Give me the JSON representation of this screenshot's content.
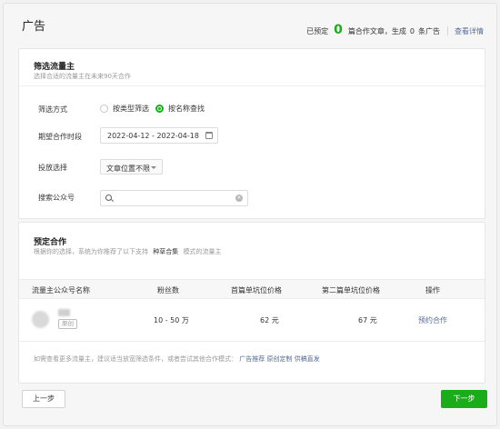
{
  "header": {
    "title": "广告",
    "summary_prefix": "已预定",
    "reserved_count": "0",
    "summary_middle": "篇合作文章，生成",
    "ad_count": "0",
    "summary_suffix": "条广告",
    "details_link": "查看详情"
  },
  "filter": {
    "title": "筛选流量主",
    "subtitle": "选择合适的流量主在未来90天合作",
    "method_label": "筛选方式",
    "method_options": [
      "按类型筛选",
      "按名称查找"
    ],
    "method_selected": "按名称查找",
    "period_label": "期望合作时段",
    "period_value": "2022-04-12 - 2022-04-18",
    "placement_label": "投放选择",
    "placement_value": "文章位置不限",
    "search_label": "搜索公众号",
    "search_value": ""
  },
  "reserve": {
    "title": "预定合作",
    "subtitle_parts": [
      "根据你的选择，系统为你推荐了以下支持",
      "种草合集",
      "模式的流量主"
    ],
    "columns": [
      "流量主公众号名称",
      "粉丝数",
      "首篇单坑位价格",
      "第二篇单坑位价格",
      "操作"
    ],
    "rows": [
      {
        "tag": "原创",
        "fans": "10 - 50 万",
        "first_price": "62 元",
        "second_price": "67 元",
        "action": "预约合作"
      }
    ],
    "note": "如需查看更多流量主，建议适当放宽筛选条件，或者尝试其他合作模式：",
    "note_links": [
      "广告推荐",
      "原创定制",
      "供稿直发"
    ]
  },
  "footer": {
    "prev_label": "上一步",
    "next_label": "下一步"
  },
  "colors": {
    "accent": "#1aad19",
    "link": "#576b95"
  }
}
